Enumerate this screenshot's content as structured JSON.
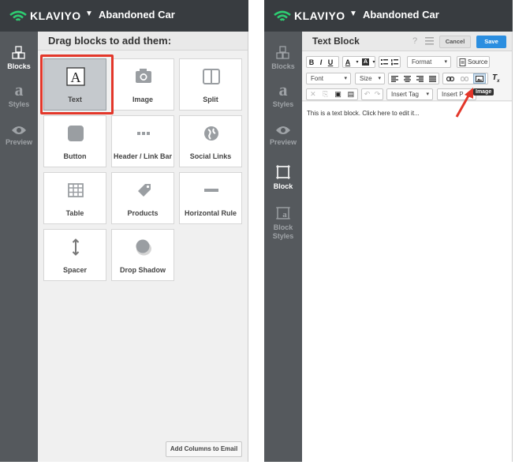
{
  "left": {
    "brand": "KLAVIYO",
    "title": "Abandoned Car",
    "nav": [
      {
        "label": "Blocks",
        "icon": "blocks-icon"
      },
      {
        "label": "Styles",
        "icon": "styles-icon"
      },
      {
        "label": "Preview",
        "icon": "eye-icon"
      }
    ],
    "header": "Drag blocks to add them:",
    "blocks": [
      {
        "label": "Text",
        "icon": "text-icon"
      },
      {
        "label": "Image",
        "icon": "camera-icon"
      },
      {
        "label": "Split",
        "icon": "split-icon"
      },
      {
        "label": "Button",
        "icon": "button-icon"
      },
      {
        "label": "Header / Link Bar",
        "icon": "dots-icon"
      },
      {
        "label": "Social Links",
        "icon": "globe-icon"
      },
      {
        "label": "Table",
        "icon": "table-icon"
      },
      {
        "label": "Products",
        "icon": "tag-icon"
      },
      {
        "label": "Horizontal Rule",
        "icon": "rule-icon"
      },
      {
        "label": "Spacer",
        "icon": "spacer-icon"
      },
      {
        "label": "Drop Shadow",
        "icon": "shadow-icon"
      }
    ],
    "add_columns": "Add Columns to Email"
  },
  "right": {
    "brand": "KLAVIYO",
    "title": "Abandoned Car",
    "nav": [
      {
        "label": "Blocks",
        "icon": "blocks-icon"
      },
      {
        "label": "Styles",
        "icon": "styles-icon"
      },
      {
        "label": "Preview",
        "icon": "eye-icon"
      },
      {
        "label": "Block",
        "icon": "block-icon"
      },
      {
        "label": "Block\nStyles",
        "icon": "block-styles-icon"
      }
    ],
    "editor_title": "Text Block",
    "help": "?",
    "cancel": "Cancel",
    "save": "Save",
    "toolbar": {
      "bold": "B",
      "italic": "I",
      "underline": "U",
      "text_color": "A",
      "bg_color": "A",
      "format": "Format",
      "source": "Source",
      "font": "Font",
      "size": "Size",
      "insert_tag": "Insert Tag",
      "insert_p": "Insert P",
      "tooltip": "Image"
    },
    "body_text": "This is a text block. Click here to edit it..."
  },
  "colors": {
    "topbar": "#383c40",
    "sidenav": "#55595d",
    "highlight": "#e3372a",
    "save": "#2b8ee0",
    "brand_green": "#2ecc71"
  }
}
